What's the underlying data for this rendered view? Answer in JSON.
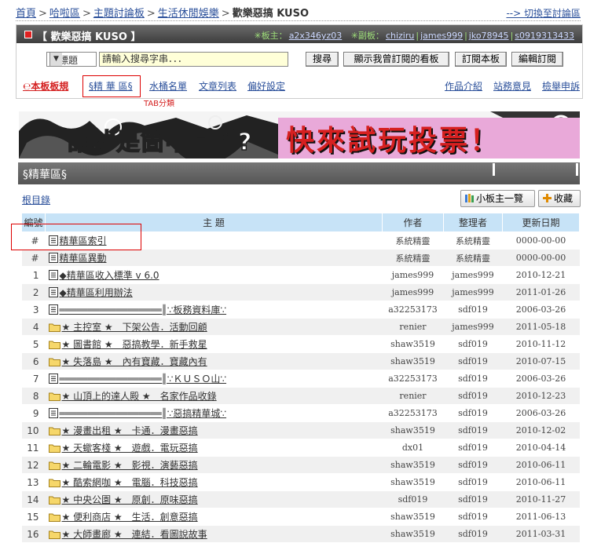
{
  "breadcrumb": {
    "items": [
      "首頁",
      "哈啦區",
      "主題討論板",
      "生活休閒娛樂"
    ],
    "current": "歡樂惡搞 KUSO",
    "switch_link": "--> 切換至討論區"
  },
  "board": {
    "title": "【 歡樂惡搞 KUSO 】",
    "moderator_label": "✳板主：",
    "moderators": [
      "a2x346yz03"
    ],
    "vice_label": "✳副板：",
    "vice_moderators": [
      "chiziru",
      "james999",
      "jko78945",
      "s0919313433"
    ]
  },
  "search": {
    "select_value": "找標題",
    "placeholder": "請輸入搜尋字串．．．",
    "search_button": "搜尋",
    "show_subscribed": "顯示我曾訂閱的看板",
    "subscribe": "訂閱本板",
    "edit_subscribe": "編輯訂閱"
  },
  "tabs": {
    "rules": "℮本板板規",
    "jinghua": "§精 華 區§",
    "bucket": "水桶名單",
    "articles": "文章列表",
    "prefs": "偏好設定",
    "works": "作品介紹",
    "feedback": "站務意見",
    "report": "檢舉申訴",
    "note": "TAB分類"
  },
  "banner": {
    "text1": "誰才是箇中高手?",
    "text2": "快來試玩投票！"
  },
  "section": {
    "title": "§精華區§"
  },
  "toolbar": {
    "root": "根目錄",
    "mini_mod": "小板主一覽",
    "favorite": "收藏"
  },
  "table": {
    "headers": [
      "編號",
      "主 題",
      "作者",
      "整理者",
      "更新日期"
    ],
    "rows": [
      {
        "num": "#",
        "icon": "doc",
        "title": "精華區索引",
        "author": "系統精靈",
        "editor": "系統精靈",
        "date": "0000-00-00"
      },
      {
        "num": "#",
        "icon": "doc",
        "title": "精華區異動",
        "author": "系統精靈",
        "editor": "系統精靈",
        "date": "0000-00-00"
      },
      {
        "num": "1",
        "icon": "doc",
        "title": "◆精華區收入標準 v 6.0",
        "author": "james999",
        "editor": "james999",
        "date": "2010-12-21"
      },
      {
        "num": "2",
        "icon": "doc",
        "title": "◆精華區利用辦法",
        "author": "james999",
        "editor": "james999",
        "date": "2011-01-26"
      },
      {
        "num": "3",
        "icon": "doc",
        "title": "══════════════════║∵板務資料庫∵",
        "author": "a32253173",
        "editor": "sdf019",
        "date": "2006-03-26"
      },
      {
        "num": "4",
        "icon": "folder",
        "title": "★ 主控室 ★　下架公告．活動回顧",
        "author": "renier",
        "editor": "james999",
        "date": "2011-05-18"
      },
      {
        "num": "5",
        "icon": "folder",
        "title": "★ 圖書館 ★　惡搞教學．新手救星",
        "author": "shaw3519",
        "editor": "sdf019",
        "date": "2010-11-12"
      },
      {
        "num": "6",
        "icon": "folder",
        "title": "★ 失落島 ★　內有寶藏．寶藏內有",
        "author": "shaw3519",
        "editor": "sdf019",
        "date": "2010-07-15"
      },
      {
        "num": "7",
        "icon": "doc",
        "title": "══════════════════║∵ＫＵＳＯ山∵",
        "author": "a32253173",
        "editor": "sdf019",
        "date": "2006-03-26"
      },
      {
        "num": "8",
        "icon": "folder",
        "title": "★ 山頂上的達人殿 ★　名家作品收錄",
        "author": "renier",
        "editor": "sdf019",
        "date": "2010-12-23"
      },
      {
        "num": "9",
        "icon": "doc",
        "title": "══════════════════║∵惡搞精華城∵",
        "author": "a32253173",
        "editor": "sdf019",
        "date": "2006-03-26"
      },
      {
        "num": "10",
        "icon": "folder",
        "title": "★ 漫畫出租 ★　卡通．漫畫惡搞",
        "author": "shaw3519",
        "editor": "sdf019",
        "date": "2010-12-02"
      },
      {
        "num": "11",
        "icon": "folder",
        "title": "★ 天蠍客棧 ★　遊戲．電玩惡搞",
        "author": "dx01",
        "editor": "sdf019",
        "date": "2010-04-14"
      },
      {
        "num": "12",
        "icon": "folder",
        "title": "★ 二輪電影 ★　影視．演藝惡搞",
        "author": "shaw3519",
        "editor": "sdf019",
        "date": "2010-06-11"
      },
      {
        "num": "13",
        "icon": "folder",
        "title": "★ 酷索網咖 ★　電腦．科技惡搞",
        "author": "shaw3519",
        "editor": "sdf019",
        "date": "2010-06-11"
      },
      {
        "num": "14",
        "icon": "folder",
        "title": "★ 中央公園 ★　原創．原味惡搞",
        "author": "sdf019",
        "editor": "sdf019",
        "date": "2010-11-27"
      },
      {
        "num": "15",
        "icon": "folder",
        "title": "★ 便利商店 ★　生活．創意惡搞",
        "author": "shaw3519",
        "editor": "sdf019",
        "date": "2011-06-13"
      },
      {
        "num": "16",
        "icon": "folder",
        "title": "★ 大師畫廊 ★　連結．看圖說故事",
        "author": "shaw3519",
        "editor": "sdf019",
        "date": "2011-03-31"
      }
    ]
  },
  "colors": {
    "link": "#2a4f9a",
    "header_bg": "#c7e3f7",
    "alert": "#d42020",
    "title_bar": "#4a4a4a"
  }
}
